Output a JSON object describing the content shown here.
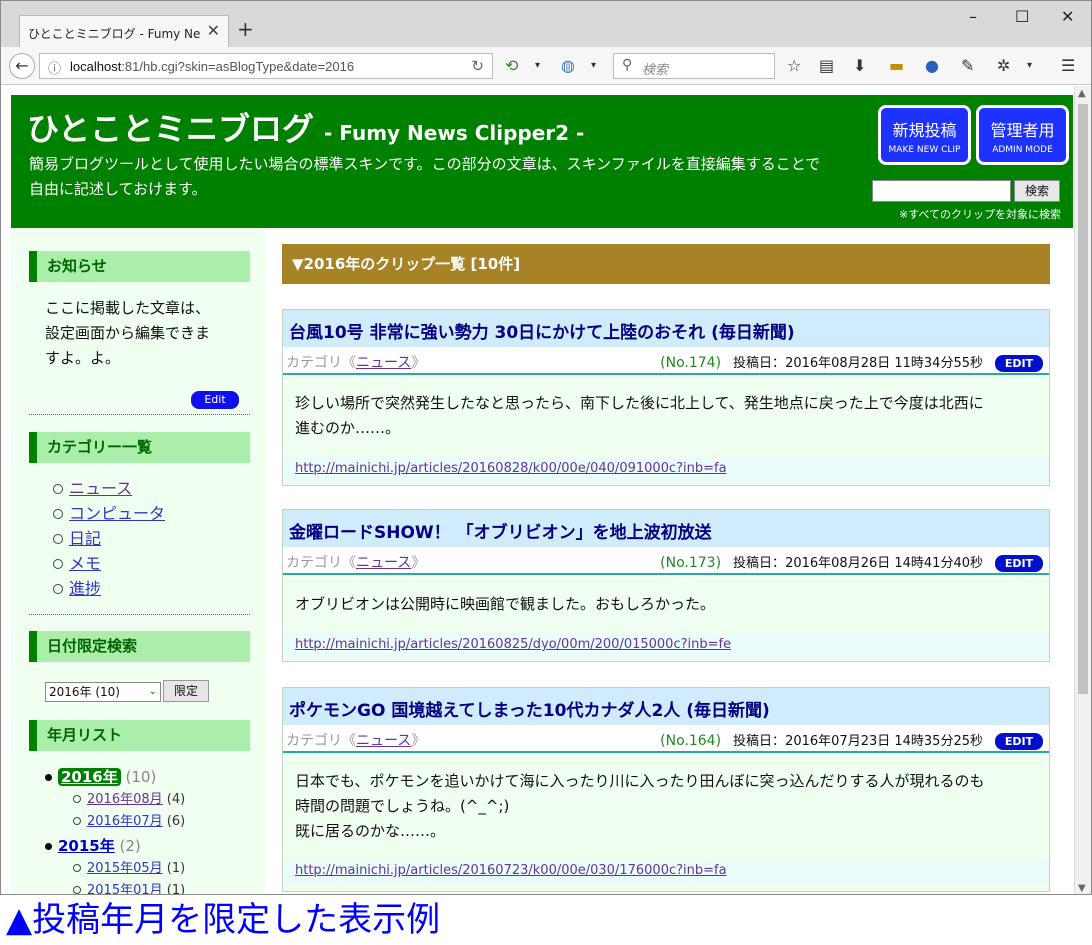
{
  "browser": {
    "tab_title": "ひとことミニブログ - Fumy News C...",
    "tab_close": "✕",
    "new_tab": "+",
    "url_host": "localhost",
    "url_rest": ":81/hb.cgi?skin=asBlogType&date=2016",
    "search_placeholder": "検索",
    "window_minimize": "–",
    "window_maximize": "☐",
    "window_close": "✕"
  },
  "header": {
    "title": "ひとことミニブログ",
    "subtitle": "- Fumy News Clipper2 -",
    "description": "簡易ブログツールとして使用したい場合の標準スキンです。この部分の文章は、スキンファイルを直接編集することで自由に記述しておけます。",
    "new_post_label": "新規投稿",
    "new_post_sub": "MAKE NEW CLIP",
    "admin_label": "管理者用",
    "admin_sub": "ADMIN MODE",
    "search_button": "検索",
    "search_note": "※すべてのクリップを対象に検索"
  },
  "sidebar": {
    "notice_head": "お知らせ",
    "notice_lines": [
      "ここに掲載した文章は、",
      "設定画面から編集できま",
      "すよ。よ。"
    ],
    "notice_edit": "Edit",
    "category_head": "カテゴリー一覧",
    "categories": [
      "ニュース",
      "コンピュータ",
      "日記",
      "メモ",
      "進捗"
    ],
    "date_head": "日付限定検索",
    "date_selected": "2016年 (10)",
    "date_button": "限定",
    "archive_head": "年月リスト",
    "years": [
      {
        "label": "2016年",
        "count": "(10)",
        "months": [
          {
            "label": "2016年08月",
            "count": "(4)"
          },
          {
            "label": "2016年07月",
            "count": "(6)"
          }
        ]
      },
      {
        "label": "2015年",
        "count": "(2)",
        "months": [
          {
            "label": "2015年05月",
            "count": "(1)"
          },
          {
            "label": "2015年01月",
            "count": "(1)"
          }
        ]
      }
    ]
  },
  "main": {
    "list_head": "▼2016年のクリップ一覧 [10件]",
    "category_prefix": "カテゴリ《",
    "category_suffix": "》",
    "posted_prefix": "投稿日：",
    "edit_label": "EDIT",
    "entries": [
      {
        "title": "台風10号 非常に強い勢力 30日にかけて上陸のおそれ (毎日新聞)",
        "category": "ニュース",
        "no": "(No.174)",
        "date": "2016年08月28日 11時34分55秒",
        "body": [
          "珍しい場所で突然発生したなと思ったら、南下した後に北上して、発生地点に戻った上で今度は北西に",
          "進むのか……。"
        ],
        "link": "http://mainichi.jp/articles/20160828/k00/00e/040/091000c?inb=fa"
      },
      {
        "title": "金曜ロードSHOW！ 「オブリビオン」を地上波初放送",
        "category": "ニュース",
        "no": "(No.173)",
        "date": "2016年08月26日 14時41分40秒",
        "body": [
          "オブリビオンは公開時に映画館で観ました。おもしろかった。"
        ],
        "link": "http://mainichi.jp/articles/20160825/dyo/00m/200/015000c?inb=fe"
      },
      {
        "title": "ポケモンGO 国境越えてしまった10代カナダ人2人 (毎日新聞)",
        "category": "ニュース",
        "no": "(No.164)",
        "date": "2016年07月23日 14時35分25秒",
        "body": [
          "日本でも、ポケモンを追いかけて海に入ったり川に入ったり田んぼに突っ込んだりする人が現れるのも",
          "時間の問題でしょうね。(^_^;)",
          "既に居るのかな……。"
        ],
        "link": "http://mainichi.jp/articles/20160723/k00/00e/030/176000c?inb=fa"
      }
    ]
  },
  "caption": "▲投稿年月を限定した表示例"
}
